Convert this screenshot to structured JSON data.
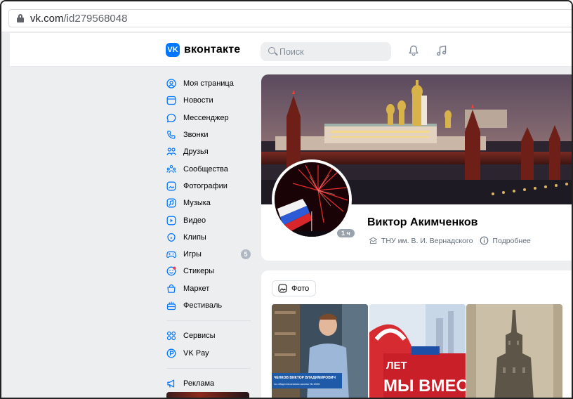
{
  "browser": {
    "url_host": "vk.com",
    "url_path": "/id279568048"
  },
  "header": {
    "logo_mark": "VK",
    "logo_text": "вконтакте",
    "search_placeholder": "Поиск"
  },
  "sidebar": {
    "items": [
      {
        "label": "Моя страница",
        "icon": "user-circle-icon"
      },
      {
        "label": "Новости",
        "icon": "news-icon"
      },
      {
        "label": "Мессенджер",
        "icon": "message-icon"
      },
      {
        "label": "Звонки",
        "icon": "phone-icon"
      },
      {
        "label": "Друзья",
        "icon": "friends-icon"
      },
      {
        "label": "Сообщества",
        "icon": "communities-icon"
      },
      {
        "label": "Фотографии",
        "icon": "photo-icon"
      },
      {
        "label": "Музыка",
        "icon": "music-icon"
      },
      {
        "label": "Видео",
        "icon": "video-icon"
      },
      {
        "label": "Клипы",
        "icon": "clips-icon"
      },
      {
        "label": "Игры",
        "icon": "gamepad-icon",
        "badge": "5"
      },
      {
        "label": "Стикеры",
        "icon": "sticker-icon"
      },
      {
        "label": "Маркет",
        "icon": "market-bag-icon"
      },
      {
        "label": "Фестиваль",
        "icon": "festival-icon"
      }
    ],
    "services": [
      {
        "label": "Сервисы",
        "icon": "services-grid-icon"
      },
      {
        "label": "VK Pay",
        "icon": "vk-pay-icon"
      }
    ],
    "ads": {
      "label": "Реклама",
      "icon": "megaphone-icon"
    }
  },
  "profile": {
    "name": "Виктор Акимченков",
    "online": "1 ч",
    "education": "ТНУ им. В. И. Вернадского",
    "more_label": "Подробнее"
  },
  "photos": {
    "tab_label": "Фото",
    "photo2_text_top": "ЛЕТ",
    "photo2_text_bottom": "МЫ ВМЕС",
    "photo1_caption_top": "ЧЕНКОВ ВИКТОР ВЛАДИМИРОВИЧ",
    "photo1_caption_bottom": "ль обществознания школы № 2005"
  },
  "colors": {
    "accent": "#0077ff",
    "page_bg": "#edeef0",
    "text_secondary": "#626d7a",
    "badge": "#aeb7c2"
  }
}
